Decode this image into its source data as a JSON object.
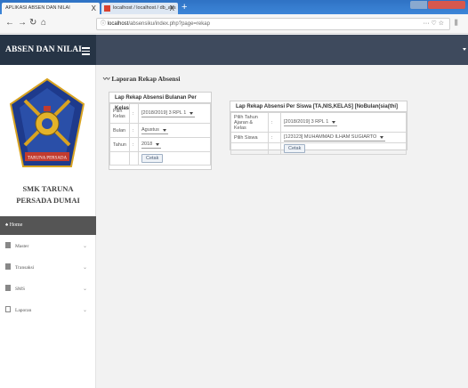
{
  "browser": {
    "tabs": [
      {
        "label": "APLIKASI ABSEN DAN NILAI",
        "close": "X"
      },
      {
        "label": "localhost / localhost / db_abs",
        "close": "X"
      }
    ],
    "new_tab": "+",
    "url_host": "localhost",
    "url_path": "/absensiku/index.php?page=rekap",
    "url_extra": "··· ♡ ☆",
    "nav_icons": [
      "back-icon",
      "forward-icon",
      "reload-icon",
      "home-icon"
    ]
  },
  "app": {
    "title": "ABSEN DAN NILAI",
    "school_line1": "SMK TARUNA",
    "school_line2": "PERSADA DUMAI",
    "logo_banner": "TARUNA PERSADA"
  },
  "menu": {
    "home": "Home",
    "items": [
      {
        "label": "Master",
        "icon": "file-icon"
      },
      {
        "label": "Transaksi",
        "icon": "file-icon"
      },
      {
        "label": "SMS",
        "icon": "file-icon"
      },
      {
        "label": "Laporan",
        "icon": "grid-icon"
      }
    ]
  },
  "page": {
    "title": "Laporan Rekap Absensi"
  },
  "panel_bulanan": {
    "heading": "Lap Rekap Absensi Bulanan Per Kelas",
    "rows": [
      {
        "label": "Pilih Kelas",
        "sep": ":",
        "value": "[2018/2019] 3 RPL 1"
      },
      {
        "label": "Bulan",
        "sep": ":",
        "value": "Agustus"
      },
      {
        "label": "Tahun",
        "sep": ":",
        "value": "2018"
      }
    ],
    "button": "Cetak"
  },
  "panel_siswa": {
    "heading": "Lap Rekap Absensi Per Siswa [TA,NIS,KELAS] [NoBulan(sia(thi]",
    "rows": [
      {
        "label": "Pilih Tahun Ajaran & Kelas",
        "sep": ":",
        "value": "[2018/2019] 3 RPL 1"
      },
      {
        "label": "Pilih Siswa",
        "sep": ":",
        "value": "[123123] MUHAMMAD ILHAM SUGIARTO"
      }
    ],
    "button": "Cetak"
  }
}
